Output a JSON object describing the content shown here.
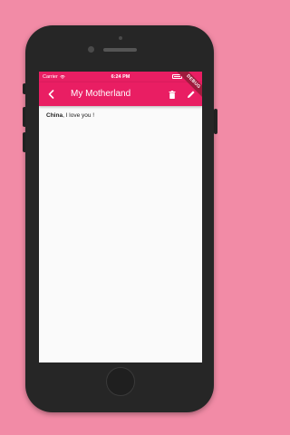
{
  "status_bar": {
    "carrier": "Carrier",
    "time": "6:24 PM"
  },
  "app_bar": {
    "title": "My Motherland",
    "back_icon": "back-arrow-icon",
    "delete_icon": "trash-icon",
    "edit_icon": "pencil-icon",
    "color": "#e91e63"
  },
  "debug_banner": "DEBUG",
  "note": {
    "bold_text": "China",
    "rest_text": ", I love you !"
  },
  "colors": {
    "background": "#f28ba6",
    "accent": "#e91e63",
    "phone_body": "#262626"
  }
}
